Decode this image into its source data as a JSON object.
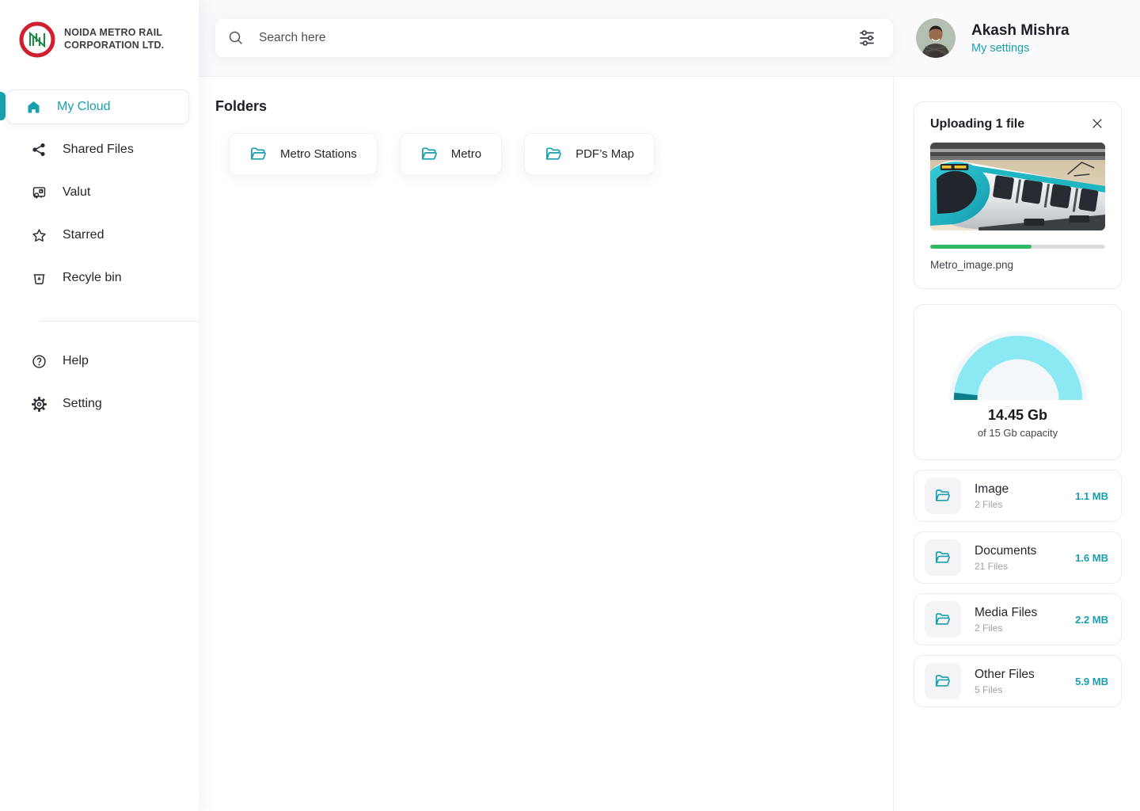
{
  "brand": {
    "name_line1": "NOIDA METRO RAIL",
    "name_line2": "CORPORATION LTD."
  },
  "sidebar": {
    "items": [
      {
        "label": "My Cloud",
        "icon": "home-icon",
        "active": true
      },
      {
        "label": "Shared Files",
        "icon": "share-icon",
        "active": false
      },
      {
        "label": "Valut",
        "icon": "vault-icon",
        "active": false
      },
      {
        "label": "Starred",
        "icon": "star-icon",
        "active": false
      },
      {
        "label": "Recyle bin",
        "icon": "recycle-bin-icon",
        "active": false
      }
    ],
    "footer_items": [
      {
        "label": "Help",
        "icon": "help-icon"
      },
      {
        "label": "Setting",
        "icon": "gear-icon"
      }
    ]
  },
  "header": {
    "search_placeholder": "Search here",
    "user_name": "Akash Mishra",
    "user_link": "My settings"
  },
  "main": {
    "section_title": "Folders",
    "folders": [
      {
        "name": "Metro Stations"
      },
      {
        "name": "Metro"
      },
      {
        "name": "PDF’s Map"
      }
    ]
  },
  "upload": {
    "title": "Uploading 1 file",
    "file_name": "Metro_image.png",
    "progress_percent": 58
  },
  "storage": {
    "used_label": "14.45 Gb",
    "capacity_label": "of 15 Gb capacity",
    "used_gb": 14.45,
    "capacity_gb": 15
  },
  "categories": [
    {
      "name": "Image",
      "files": "2 Files",
      "size": "1.1 MB"
    },
    {
      "name": "Documents",
      "files": "21 Files",
      "size": "1.6 MB"
    },
    {
      "name": "Media Files",
      "files": "2 Files",
      "size": "2.2 MB"
    },
    {
      "name": "Other Files",
      "files": "5 Files",
      "size": "5.9 MB"
    }
  ],
  "colors": {
    "accent": "#18a0af",
    "progress_green": "#2eb964",
    "gauge_used": "#8be9f3",
    "gauge_remaining": "#0f7e8c"
  }
}
